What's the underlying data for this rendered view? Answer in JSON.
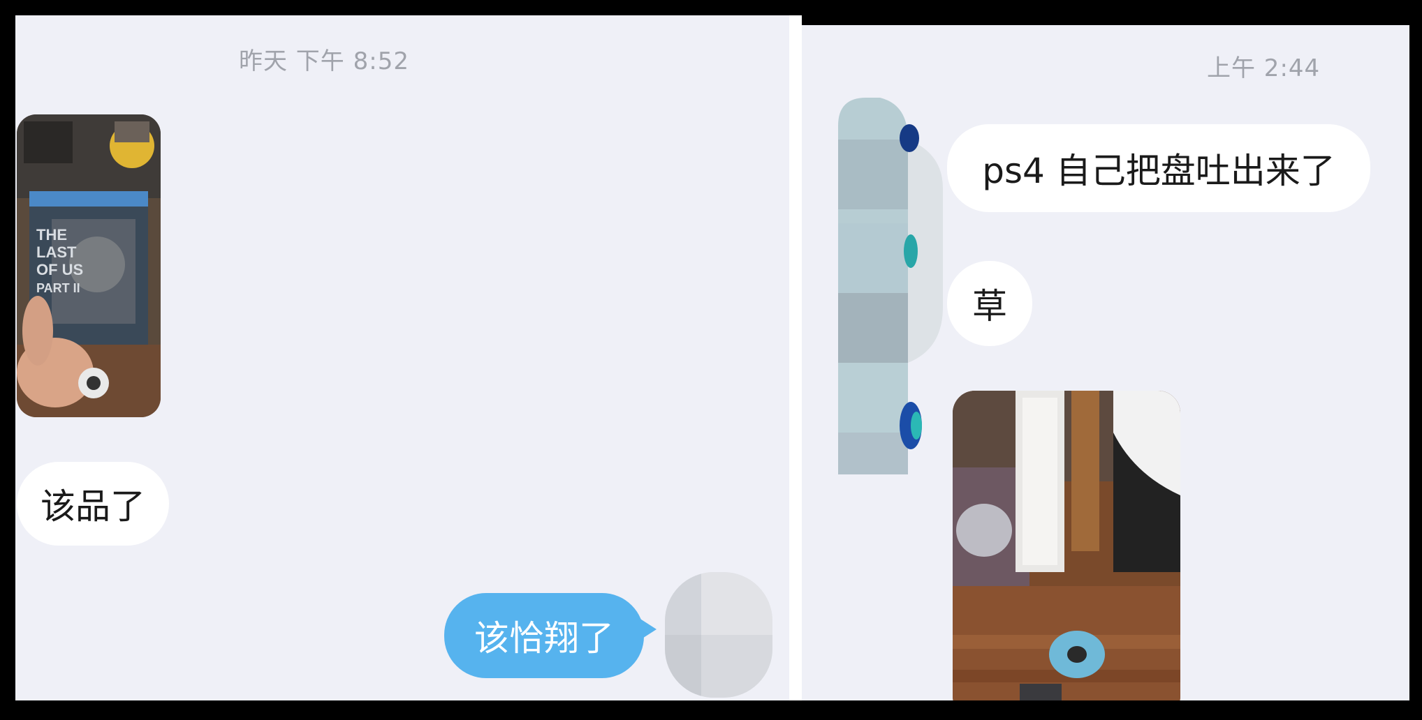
{
  "left_chat": {
    "timestamp": "昨天 下午 8:52",
    "messages": [
      {
        "sender": "other",
        "type": "image",
        "description": "game-box-photo"
      },
      {
        "sender": "other",
        "type": "text",
        "text": "该品了"
      },
      {
        "sender": "self",
        "type": "text",
        "text": "该恰翔了"
      }
    ]
  },
  "right_chat": {
    "timestamp": "上午 2:44",
    "messages": [
      {
        "sender": "other",
        "type": "text",
        "text": "ps4 自己把盘吐出来了"
      },
      {
        "sender": "other",
        "type": "text",
        "text": "草"
      },
      {
        "sender": "other",
        "type": "image",
        "description": "console-disc-photo"
      }
    ]
  },
  "colors": {
    "background": "#eff0f7",
    "incoming_bubble": "#ffffff",
    "outgoing_bubble": "#56b3ee",
    "timestamp_text": "#a0a3ab"
  }
}
